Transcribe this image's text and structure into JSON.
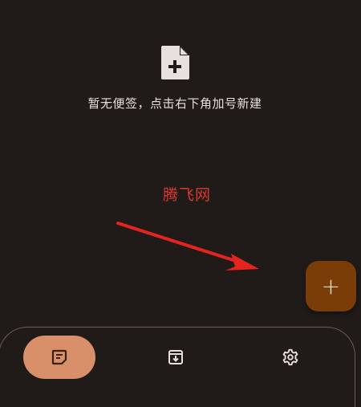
{
  "empty_state": {
    "icon": "file-add-icon",
    "message": "暂无便签，点击右下角加号新建"
  },
  "watermark": {
    "text": "腾飞网"
  },
  "fab": {
    "label": "+",
    "icon": "plus-icon"
  },
  "bottom_nav": {
    "items": [
      {
        "name": "notes",
        "icon": "note-icon",
        "active": true
      },
      {
        "name": "archive",
        "icon": "archive-download-icon",
        "active": false
      },
      {
        "name": "settings",
        "icon": "gear-icon",
        "active": false
      }
    ]
  },
  "colors": {
    "background": "#201a18",
    "fab": "#7a3d08",
    "nav_active": "#d8906a",
    "watermark": "#d8392f",
    "arrow": "#e52420"
  }
}
